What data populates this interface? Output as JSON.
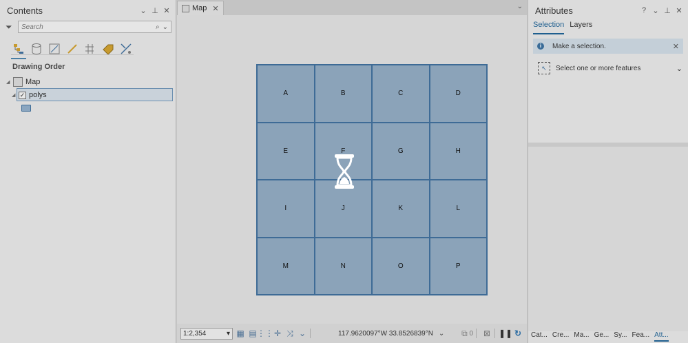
{
  "contents": {
    "title": "Contents",
    "search_placeholder": "Search",
    "section_label": "Drawing Order",
    "tree": {
      "map_label": "Map",
      "layer_label": "polys"
    }
  },
  "map_view": {
    "tab_label": "Map",
    "cells": [
      "A",
      "B",
      "C",
      "D",
      "E",
      "F",
      "G",
      "H",
      "I",
      "J",
      "K",
      "L",
      "M",
      "N",
      "O",
      "P"
    ],
    "colors": {
      "fill": "#8ba3b9",
      "outline": "#3e6b96"
    },
    "status": {
      "scale": "1:2,354",
      "coordinates": "117.9620097°W 33.8526839°N",
      "selection_count": "0"
    },
    "busy_cursor": "hourglass-icon"
  },
  "attributes": {
    "title": "Attributes",
    "tabs": [
      "Selection",
      "Layers"
    ],
    "active_tab": "Selection",
    "info_message": "Make a selection.",
    "select_prompt": "Select one or more features",
    "bottom_tabs": [
      "Cat...",
      "Cre...",
      "Ma...",
      "Ge...",
      "Sy...",
      "Fea...",
      "Att..."
    ],
    "active_bottom_tab": "Att..."
  }
}
